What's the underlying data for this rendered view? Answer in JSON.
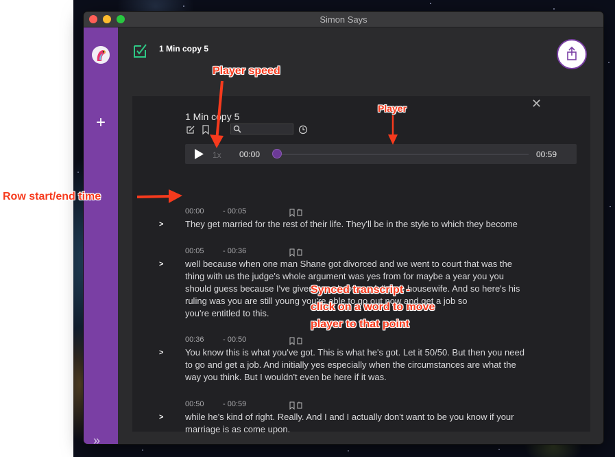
{
  "window": {
    "title": "Simon Says"
  },
  "header": {
    "doc_title": "1 Min copy 5"
  },
  "panel": {
    "title": "1 Min copy 5",
    "player": {
      "speed": "1x",
      "current_time": "00:00",
      "end_time": "00:59",
      "progress": 0
    }
  },
  "rows": [
    {
      "start": "00:00",
      "end": "00:05",
      "text": [
        "They get married for the rest of their life. They'll be in the style to which they become"
      ]
    },
    {
      "start": "00:05",
      "end": "00:36",
      "text": [
        "well because when one man Shane got divorced and we went to court that was the",
        "thing with us the judge's whole argument was yes from for maybe a year you you",
        "should guess because I've given it work to be a full time housewife. And so here's his",
        "ruling was you are still young you're able to go out now and get a job so",
        "you're entitled to this."
      ]
    },
    {
      "start": "00:36",
      "end": "00:50",
      "text": [
        "You know this is what you've got. This is what he's got. Let it 50/50. But then you need",
        "to go and get a job. And initially yes especially when the circumstances are what the",
        "way you think. But I wouldn't even be here if it was."
      ]
    },
    {
      "start": "00:50",
      "end": "00:59",
      "text": [
        "while he's kind of right. Really. And I and I actually don't want to be you know if your",
        "marriage is as come upon."
      ]
    }
  ],
  "annotations": {
    "player_speed": "Player speed",
    "player": "Player",
    "row_time": "Row start/end time",
    "synced": [
      "Synced transcript -",
      "click on a word to move",
      "player to that point"
    ]
  },
  "colors": {
    "accent": "#7a3fa4",
    "annotation": "#f63a1d"
  },
  "icons": [
    "plus-icon",
    "expand-icon",
    "edit-icon",
    "bookmark-icon",
    "search-icon",
    "clock-icon",
    "play-icon",
    "close-icon",
    "share-icon"
  ]
}
